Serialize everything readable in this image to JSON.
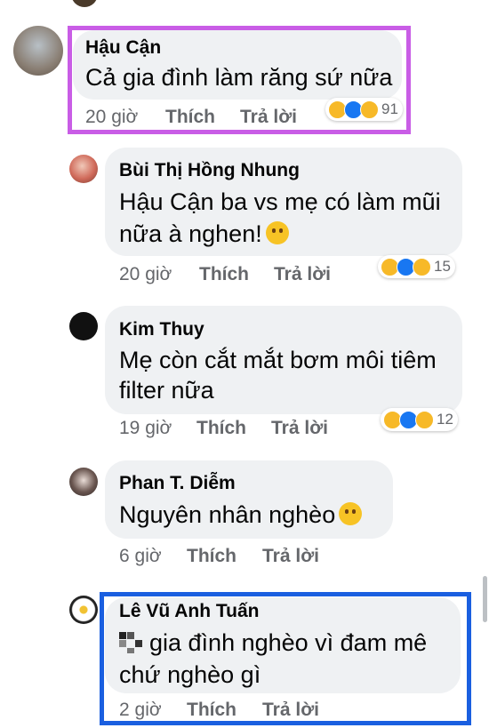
{
  "comments": [
    {
      "name": "Hậu Cận",
      "lines": [
        "Cả gia đình làm răng sứ nữa"
      ],
      "time": "20 giờ",
      "like": "Thích",
      "reply": "Trả lời",
      "reaction_count": "91"
    },
    {
      "name": "Bùi Thị Hồng Nhung",
      "lines": [
        "Hậu Cận ba vs mẹ có làm mũi",
        "nữa à nghen!"
      ],
      "emoji": "rolling-on-floor-laughing",
      "time": "20 giờ",
      "like": "Thích",
      "reply": "Trả lời",
      "reaction_count": "15"
    },
    {
      "name": "Kim Thuy",
      "lines": [
        "Mẹ còn cắt mắt bơm môi tiêm",
        "filter nữa"
      ],
      "time": "19 giờ",
      "like": "Thích",
      "reply": "Trả lời",
      "reaction_count": "12"
    },
    {
      "name": "Phan T. Diễm",
      "lines": [
        "Nguyên nhân nghèo"
      ],
      "emoji": "grinning-sweat",
      "time": "6 giờ",
      "like": "Thích",
      "reply": "Trả lời"
    },
    {
      "name": "Lê Vũ Anh Tuấn",
      "lines": [
        "gia đình nghèo vì đam mê",
        "chứ nghèo gì"
      ],
      "time": "2 giờ",
      "like": "Thích",
      "reply": "Trả lời"
    }
  ],
  "reaction_icons": [
    "haha-icon",
    "like-icon",
    "sad-icon"
  ],
  "colors": {
    "bubble": "#eff1f3",
    "meta_text": "#65676b",
    "highlight_purple": "#c95de6",
    "highlight_blue": "#1a5fe0",
    "like_blue": "#1877f2",
    "emoji_yellow": "#f7b928"
  }
}
